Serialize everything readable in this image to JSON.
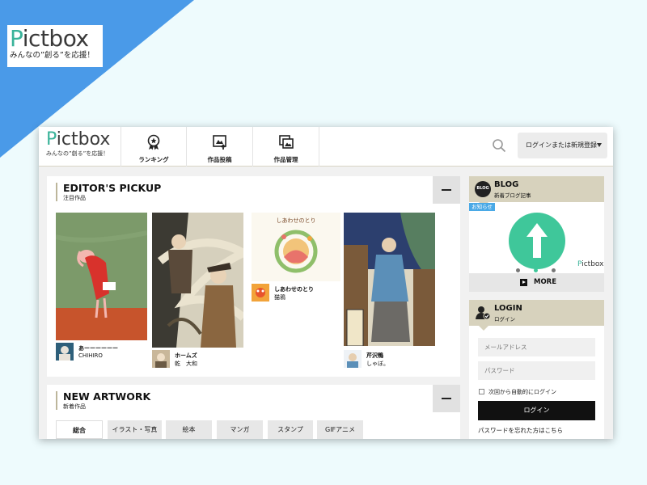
{
  "promo": {
    "logo_first": "P",
    "logo_rest": "ictbox",
    "tagline": "みんなの”創る”を応援！"
  },
  "header": {
    "logo_first": "P",
    "logo_rest": "ictbox",
    "tagline": "みんなの”創る”を応援！",
    "nav": [
      {
        "label": "ランキング",
        "icon": "ranking-badge-icon"
      },
      {
        "label": "作品投稿",
        "icon": "upload-artwork-icon"
      },
      {
        "label": "作品管理",
        "icon": "manage-artwork-icon"
      }
    ],
    "search_icon": "search-icon",
    "login_menu_label": "ログインまたは新規登録"
  },
  "pickup": {
    "title": "EDITOR'S PICKUP",
    "subtitle": "注目作品",
    "items": [
      {
        "title": "あーーーーーー",
        "author": "CHIHIRO"
      },
      {
        "title": "ホームズ",
        "author": "乾　大和"
      },
      {
        "title": "しあわせのとり",
        "author": "猫鴉",
        "cover_text": "しあわせのとり"
      },
      {
        "title": "芹沢鴨",
        "author": "しゃぼ。"
      }
    ]
  },
  "new_artwork": {
    "title": "NEW ARTWORK",
    "subtitle": "新着作品",
    "tabs": [
      "総合",
      "イラスト・写真",
      "絵本",
      "マンガ",
      "スタンプ",
      "GIFアニメ"
    ],
    "active_tab": "総合"
  },
  "blog": {
    "title": "BLOG",
    "subtitle": "新着ブログ記事",
    "badge_text": "BLOG",
    "notice_label": "お知らせ",
    "logo_first": "P",
    "logo_rest": "ictbox",
    "more_label": "MORE",
    "slide_count": 3,
    "active_slide": 2
  },
  "login": {
    "title": "LOGIN",
    "subtitle": "ログイン",
    "email_placeholder": "メールアドレス",
    "password_placeholder": "パスワード",
    "remember_label": "次回から自動的にログイン",
    "submit_label": "ログイン",
    "forgot_label": "パスワードを忘れた方はこちら"
  },
  "colors": {
    "brand_green": "#3ab39a",
    "corner_blue": "#4a9ae8",
    "section_accent": "#bdb69b",
    "side_header": "#d7d2bd",
    "blog_circle": "#3fc79a"
  }
}
